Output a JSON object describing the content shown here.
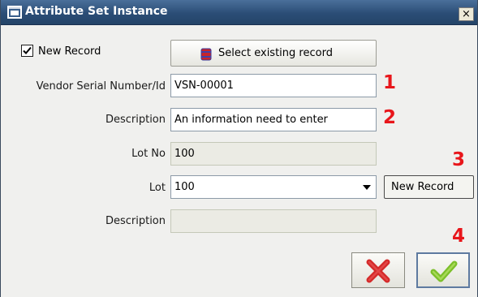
{
  "window": {
    "title": "Attribute Set Instance",
    "close_glyph": "×"
  },
  "new_record_checkbox": {
    "label": "New Record",
    "checked": true
  },
  "select_existing_button": {
    "label": "Select existing record",
    "icon": "database-icon"
  },
  "fields": {
    "vendor_serial": {
      "label": "Vendor Serial Number/Id",
      "value": "VSN-00001"
    },
    "description": {
      "label": "Description",
      "value": "An information need to enter"
    },
    "lot_no": {
      "label": "Lot No",
      "value": "100"
    },
    "lot": {
      "label": "Lot",
      "value": "100"
    },
    "lot_description": {
      "label": "Description",
      "value": ""
    }
  },
  "lot_new_record_button": {
    "label": "New Record"
  },
  "markers": [
    "1",
    "2",
    "3",
    "4"
  ],
  "actions": {
    "cancel_icon": "red-x-icon",
    "ok_icon": "green-check-icon"
  },
  "colors": {
    "titlebar": "#2b4d76",
    "marker": "#e8161b",
    "cancel": "#d42a2a",
    "ok": "#7cbf2a"
  }
}
